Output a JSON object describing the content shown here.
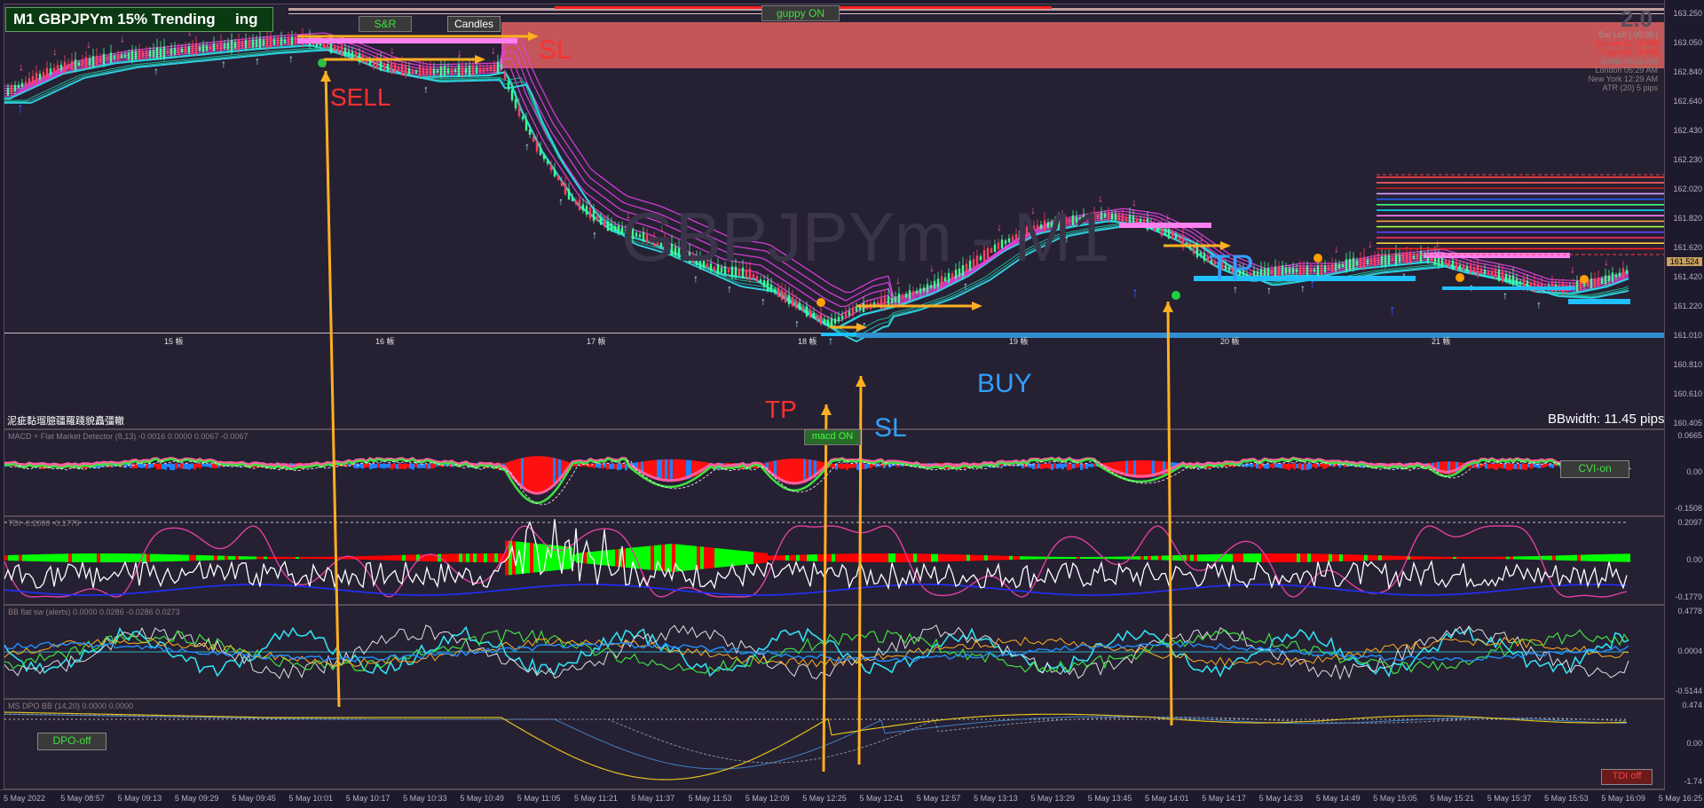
{
  "header": {
    "title": "M1 GBPJPYm 15% Trending",
    "title_suffix": "ing",
    "watermark": "GBPJPYm - M1",
    "big_digit": "2.0"
  },
  "buttons": {
    "sr": "S&R",
    "candles": "Candles",
    "guppy": "guppy ON",
    "macd": "macd ON",
    "cvi": "CVI-on",
    "dpo": "DPO-off",
    "tdi": "TDI off"
  },
  "annotations": {
    "sell": "SELL",
    "sl_top": "SL",
    "tp_right": "TP",
    "buy": "BUY",
    "tp_low": "TP",
    "sl_low": "SL",
    "bbwidth": "BBwidth: 11.45 pips"
  },
  "info": [
    {
      "text": "Bar Left   [ 00:09 ]",
      "color": "#9a9090"
    },
    {
      "text": "* Sydney   02:29 PM",
      "color": "#ff3030"
    },
    {
      "text": "* Tokyo   01:29 PM",
      "color": "#ff3030"
    },
    {
      "text": "Berlin   06:29 AM",
      "color": "#8a8080"
    },
    {
      "text": "London   05:29 AM",
      "color": "#8a8080"
    },
    {
      "text": "New York   12:29 AM",
      "color": "#8a8080"
    },
    {
      "text": "ATR (20)  5 pips",
      "color": "#8a8080"
    }
  ],
  "price_axis": [
    "163.250",
    "163.050",
    "162.840",
    "162.640",
    "162.430",
    "162.230",
    "162.020",
    "161.820",
    "161.620",
    "161.420",
    "161.220",
    "161.010",
    "160.810",
    "160.610",
    "160.405"
  ],
  "current_price": "161.524",
  "day_labels": [
    "15 帳",
    "16 帳",
    "17 帳",
    "18 帳",
    "19 帳",
    "20 帳",
    "21 帳"
  ],
  "garbled_label": "泥疵黏瑠臆疆羅踐貌矗彊轍",
  "panes": {
    "macd": {
      "title": "MACD + Flat Market Detector (8,13) -0.0016 0.0000 0.0067 -0.0067",
      "ticks": [
        "0.0665",
        "0.00",
        "-0.1508"
      ]
    },
    "tdi": {
      "title": "TDI -0.2000 -0.1779",
      "ticks": [
        "0.2097",
        "0.00",
        "-0.1779"
      ]
    },
    "bbflat": {
      "title": "BB flat sw (alerts) 0.0000 0.0286 -0.0286 0.0273",
      "ticks": [
        "0.4778",
        "0.0004",
        "-0.5144"
      ]
    },
    "dpo": {
      "title": "MS DPO BB (14,20) 0.0000 0.0000",
      "ticks": [
        "0.474",
        "0.00",
        "-1.74"
      ]
    }
  },
  "time_axis": [
    "5 May 2022",
    "5 May 08:57",
    "5 May 09:13",
    "5 May 09:29",
    "5 May 09:45",
    "5 May 10:01",
    "5 May 10:17",
    "5 May 10:33",
    "5 May 10:49",
    "5 May 11:05",
    "5 May 11:21",
    "5 May 11:37",
    "5 May 11:53",
    "5 May 12:09",
    "5 May 12:25",
    "5 May 12:41",
    "5 May 12:57",
    "5 May 13:13",
    "5 May 13:29",
    "5 May 13:45",
    "5 May 14:01",
    "5 May 14:17",
    "5 May 14:33",
    "5 May 14:49",
    "5 May 15:05",
    "5 May 15:21",
    "5 May 15:37",
    "5 May 15:53",
    "5 May 16:09",
    "5 May 16:25"
  ],
  "colors": {
    "bg": "#262033",
    "resistance_zone": "#e06060",
    "aqua": "#30e0f0",
    "magenta": "#e040e0",
    "orange": "#ffb020",
    "sell_red": "#ff3030",
    "buy_blue": "#30a0ff",
    "green": "#00ff00",
    "red": "#ff0000"
  }
}
